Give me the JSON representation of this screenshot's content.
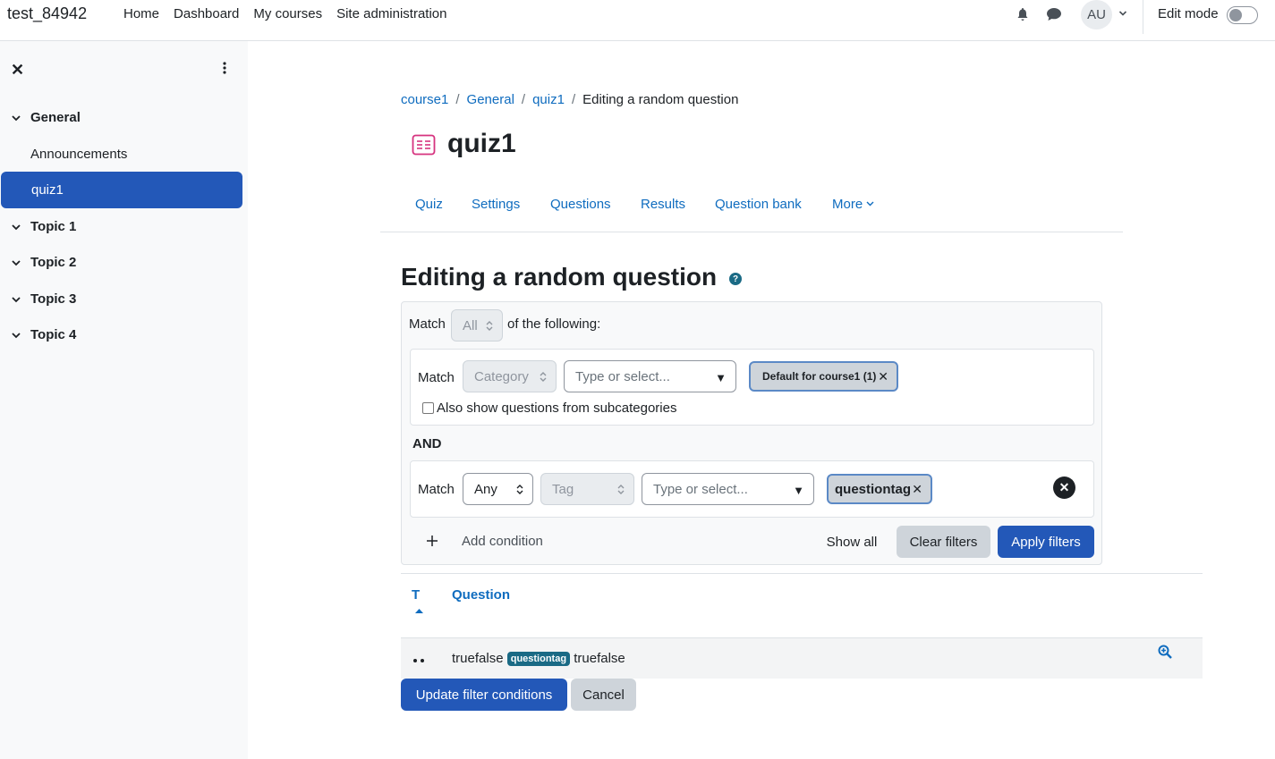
{
  "navbar": {
    "site_name": "test_84942",
    "links": [
      "Home",
      "Dashboard",
      "My courses",
      "Site administration"
    ],
    "avatar_initials": "AU",
    "edit_mode_label": "Edit mode",
    "edit_mode_on": false
  },
  "drawer": {
    "sections": [
      {
        "label": "General",
        "expanded": true,
        "activities": [
          {
            "label": "Announcements",
            "active": false
          },
          {
            "label": "quiz1",
            "active": true
          }
        ]
      },
      {
        "label": "Topic 1",
        "expanded": true
      },
      {
        "label": "Topic 2",
        "expanded": true
      },
      {
        "label": "Topic 3",
        "expanded": true
      },
      {
        "label": "Topic 4",
        "expanded": true
      }
    ]
  },
  "breadcrumb": [
    "course1",
    "General",
    "quiz1",
    "Editing a random question"
  ],
  "page": {
    "title": "quiz1",
    "tabs": [
      "Quiz",
      "Settings",
      "Questions",
      "Results",
      "Question bank",
      "More"
    ],
    "heading": "Editing a random question",
    "help_glyph": "?"
  },
  "filters": {
    "match_label": "Match",
    "match_all_value": "All",
    "of_following": "of the following:",
    "condition1": {
      "match_label": "Match",
      "type_value": "Category",
      "search_placeholder": "Type or select...",
      "selected": "Default for course1 (1)",
      "subcategories_label": "Also show questions from subcategories"
    },
    "join_label": "AND",
    "condition2": {
      "match_label": "Match",
      "match_value": "Any",
      "type_value": "Tag",
      "search_placeholder": "Type or select...",
      "selected": "questiontag"
    },
    "add_condition": "Add condition",
    "show_all": "Show all",
    "clear_filters": "Clear filters",
    "apply_filters": "Apply filters"
  },
  "table": {
    "col_type": "T",
    "col_question": "Question",
    "rows": [
      {
        "name": "truefalse",
        "tag": "questiontag",
        "text": "truefalse"
      }
    ]
  },
  "actions": {
    "update": "Update filter conditions",
    "cancel": "Cancel"
  },
  "colors": {
    "primary": "#2358b8",
    "link": "#0f6cbf",
    "badge": "#1a6a85",
    "quiz_icon": "#d6337f"
  }
}
